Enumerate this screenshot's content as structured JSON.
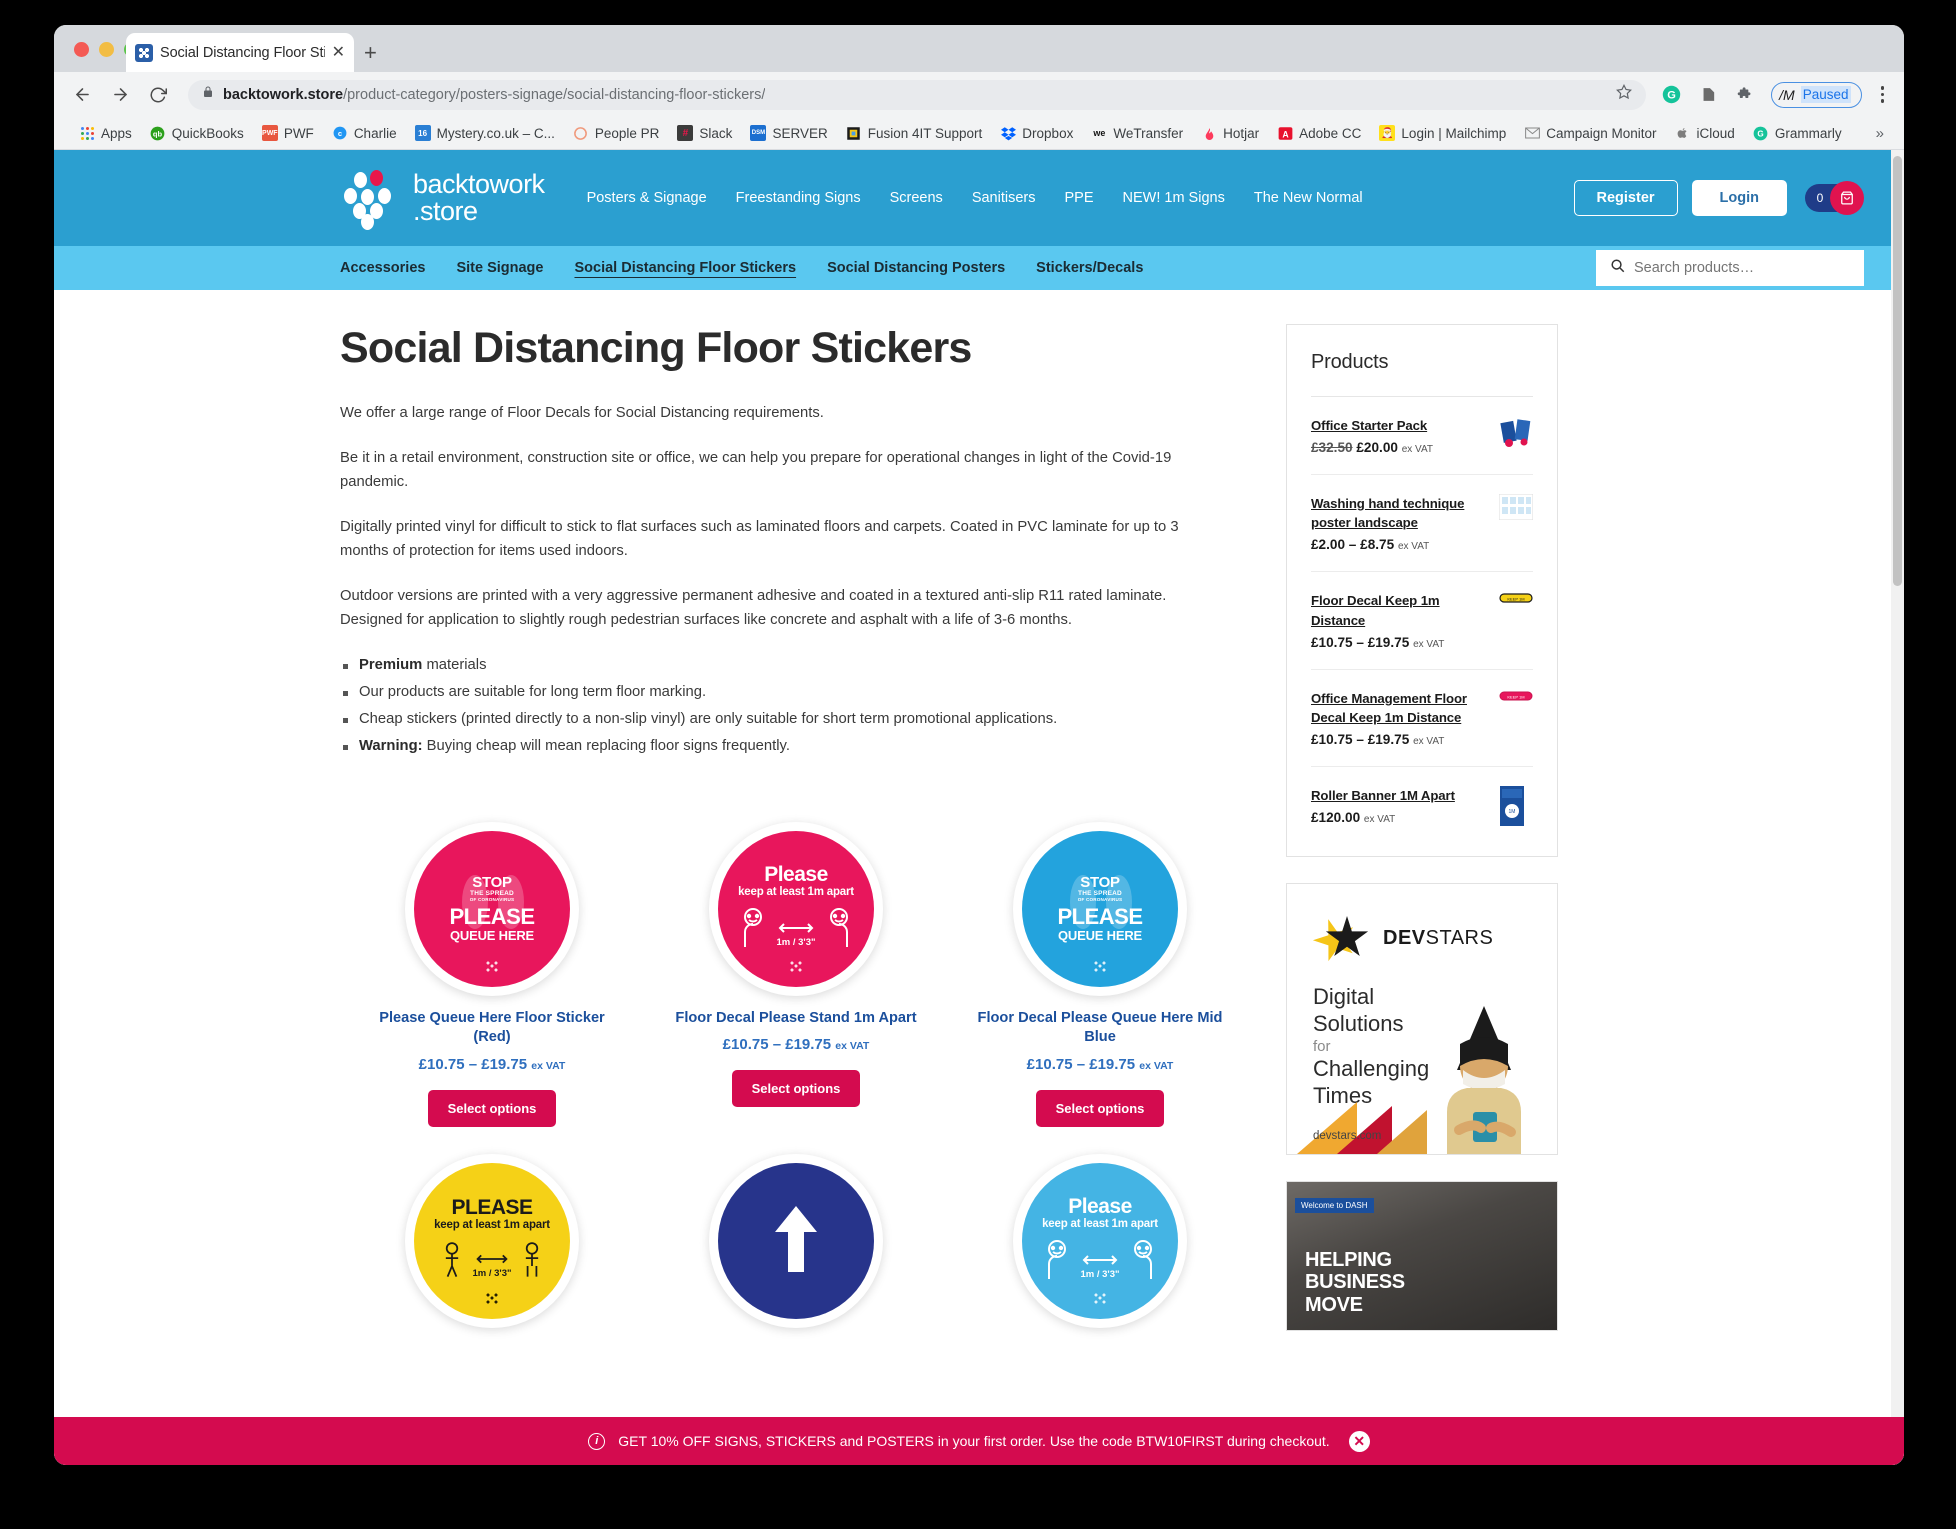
{
  "browser": {
    "tab": {
      "title": "Social Distancing Floor Stickers",
      "favicon": "backtowork-favicon",
      "close": "✕"
    },
    "newtab_label": "+",
    "url_domain": "backtowork.store",
    "url_path": "/product-category/posters-signage/social-distancing-floor-stickers/",
    "profile_badge": "Paused",
    "profile_initial": "/M",
    "bookmarks": [
      {
        "label": "Apps",
        "icon": "apps-grid-icon"
      },
      {
        "label": "QuickBooks",
        "icon": "quickbooks-icon"
      },
      {
        "label": "PWF",
        "icon": "pwf-icon"
      },
      {
        "label": "Charlie",
        "icon": "charlie-icon"
      },
      {
        "label": "Mystery.co.uk – C...",
        "icon": "mystery-calendar-icon"
      },
      {
        "label": "People PR",
        "icon": "people-pr-icon"
      },
      {
        "label": "Slack",
        "icon": "slack-icon"
      },
      {
        "label": "SERVER",
        "icon": "dsm-server-icon"
      },
      {
        "label": "Fusion 4IT Support",
        "icon": "fusion-icon"
      },
      {
        "label": "Dropbox",
        "icon": "dropbox-icon"
      },
      {
        "label": "WeTransfer",
        "icon": "wetransfer-icon"
      },
      {
        "label": "Hotjar",
        "icon": "hotjar-icon"
      },
      {
        "label": "Adobe CC",
        "icon": "adobe-cc-icon"
      },
      {
        "label": "Login | Mailchimp",
        "icon": "mailchimp-icon"
      },
      {
        "label": "Campaign Monitor",
        "icon": "campaign-monitor-icon"
      },
      {
        "label": "iCloud",
        "icon": "apple-icloud-icon"
      },
      {
        "label": "Grammarly",
        "icon": "grammarly-icon"
      }
    ],
    "bookmarks_overflow": "»"
  },
  "site": {
    "logo": {
      "line1": "backtowork",
      "line2": ".store"
    },
    "mainnav": [
      {
        "label": "Posters & Signage"
      },
      {
        "label": "Freestanding Signs"
      },
      {
        "label": "Screens"
      },
      {
        "label": "Sanitisers"
      },
      {
        "label": "PPE"
      },
      {
        "label": "NEW! 1m Signs"
      },
      {
        "label": "The New Normal"
      }
    ],
    "register_label": "Register",
    "login_label": "Login",
    "cart_count": "0",
    "subnav": [
      {
        "label": "Accessories",
        "active": false
      },
      {
        "label": "Site Signage",
        "active": false
      },
      {
        "label": "Social Distancing Floor Stickers",
        "active": true
      },
      {
        "label": "Social Distancing Posters",
        "active": false
      },
      {
        "label": "Stickers/Decals",
        "active": false
      }
    ],
    "search_placeholder": "Search products…",
    "colors": {
      "header_blue": "#2b9fd0",
      "subnav_blue": "#5ac8f0",
      "accent_pink": "#d40b4f",
      "link_blue": "#1b4f9c"
    }
  },
  "page": {
    "title": "Social Distancing Floor Stickers",
    "paragraphs": [
      "We offer a large range of Floor Decals for Social Distancing requirements.",
      "Be it in a retail environment, construction site or office, we can help you prepare for operational changes in light of the Covid-19 pandemic.",
      "Digitally printed vinyl for difficult to stick to flat surfaces such as laminated floors and carpets. Coated in PVC laminate for up to 3 months of protection for items used indoors.",
      "Outdoor versions are printed with a very aggressive permanent adhesive and coated in a textured anti-slip R11 rated laminate. Designed for application to slightly rough pedestrian surfaces like concrete and asphalt with a life of 3-6 months."
    ],
    "features": [
      {
        "bold": "Premium",
        "rest": " materials"
      },
      {
        "bold": "",
        "rest": "Our products are suitable for long term floor marking."
      },
      {
        "bold": "",
        "rest": "Cheap stickers (printed directly to a non-slip vinyl) are only suitable for short term promotional applications."
      },
      {
        "bold": "Warning:",
        "rest": " Buying cheap will mean replacing floor signs frequently."
      }
    ],
    "select_options_label": "Select options",
    "products": [
      {
        "title": "Please Queue Here Floor Sticker (Red)",
        "price": "£10.75 – £19.75",
        "vat": "ex VAT",
        "sticker": {
          "style": "pink",
          "type": "queue",
          "stop1": "STOP",
          "stop2": "THE SPREAD",
          "stop3": "OF CORONAVIRUS",
          "main1": "PLEASE",
          "main2": "QUEUE HERE"
        }
      },
      {
        "title": "Floor Decal Please Stand 1m Apart",
        "price": "£10.75 – £19.75",
        "vat": "ex VAT",
        "sticker": {
          "style": "pink",
          "type": "distance",
          "top1": "Please",
          "top2": "keep at least 1m apart",
          "dist": "1m / 3'3\""
        }
      },
      {
        "title": "Floor Decal Please Queue Here Mid Blue",
        "price": "£10.75 – £19.75",
        "vat": "ex VAT",
        "sticker": {
          "style": "midblue",
          "type": "queue",
          "stop1": "STOP",
          "stop2": "THE SPREAD",
          "stop3": "OF CORONAVIRUS",
          "main1": "PLEASE",
          "main2": "QUEUE HERE"
        }
      },
      {
        "title": "",
        "price": "",
        "vat": "",
        "sticker": {
          "style": "yellow",
          "type": "distance",
          "top1": "PLEASE",
          "top2": "keep at least 1m apart",
          "dist": "1m / 3'3\""
        }
      },
      {
        "title": "",
        "price": "",
        "vat": "",
        "sticker": {
          "style": "navy",
          "type": "arrow"
        }
      },
      {
        "title": "",
        "price": "",
        "vat": "",
        "sticker": {
          "style": "ltblue",
          "type": "distance",
          "top1": "Please",
          "top2": "keep at least 1m apart",
          "dist": "1m / 3'3\""
        }
      }
    ]
  },
  "sidebar": {
    "widget_title": "Products",
    "products": [
      {
        "name": "Office Starter Pack",
        "old_price": "£32.50",
        "price": "£20.00",
        "vat": "ex VAT",
        "thumb": "office-starter-pack-thumb"
      },
      {
        "name": "Washing hand technique poster landscape",
        "old_price": "",
        "price": "£2.00 – £8.75",
        "vat": "ex VAT",
        "thumb": "washing-hand-poster-thumb"
      },
      {
        "name": "Floor Decal Keep 1m Distance",
        "old_price": "",
        "price": "£10.75 – £19.75",
        "vat": "ex VAT",
        "thumb": "floor-decal-yellow-thumb"
      },
      {
        "name": "Office Management Floor Decal Keep 1m Distance",
        "old_price": "",
        "price": "£10.75 – £19.75",
        "vat": "ex VAT",
        "thumb": "floor-decal-pink-thumb"
      },
      {
        "name": "Roller Banner 1M Apart",
        "old_price": "",
        "price": "£120.00",
        "vat": "ex VAT",
        "thumb": "roller-banner-thumb"
      }
    ],
    "ad": {
      "brand_bold": "DEV",
      "brand_light": "STARS",
      "line1": "Digital",
      "line2": "Solutions",
      "line3": "for",
      "line4": "Challenging",
      "line5": "Times",
      "url": "devstars.com"
    },
    "ad2": {
      "tag": "Welcome to DASH",
      "line1": "HELPING",
      "line2": "BUSINESS",
      "line3": "MOVE"
    }
  },
  "notification": {
    "text": "GET 10% OFF SIGNS, STICKERS and POSTERS in your first order. Use the code BTW10FIRST during checkout.",
    "close": "✕"
  }
}
